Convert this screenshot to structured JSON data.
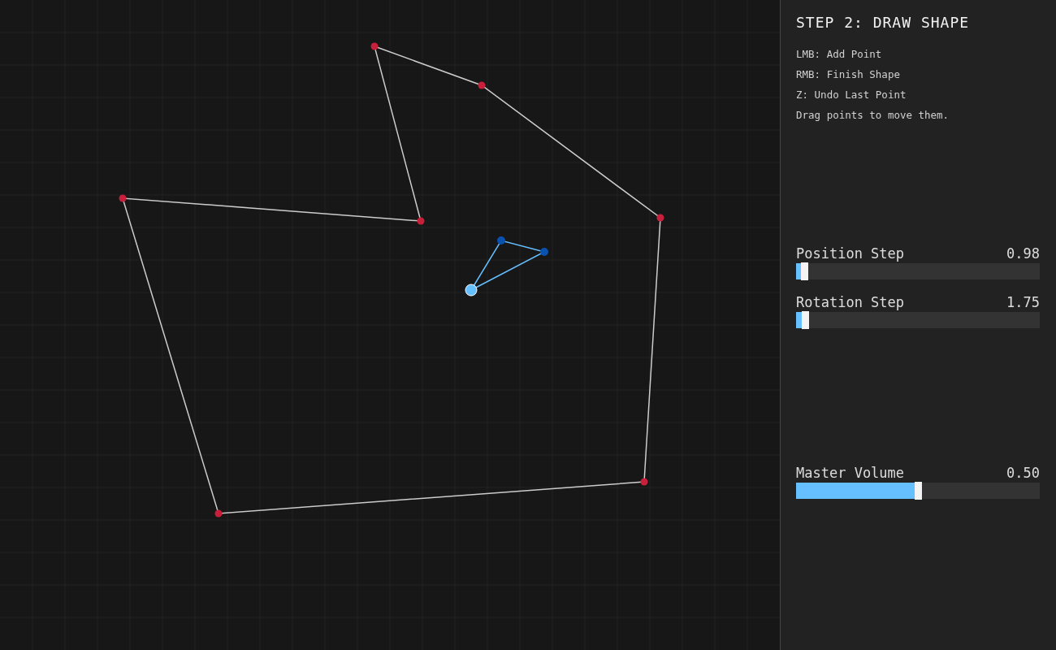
{
  "panel": {
    "title": "STEP 2: DRAW SHAPE",
    "instructions": [
      "LMB: Add Point",
      "RMB: Finish Shape",
      "Z: Undo Last Point",
      "Drag points to move them."
    ],
    "sliders": [
      {
        "label": "Position Step",
        "reading": "0.98",
        "level": 0.033
      },
      {
        "label": "Rotation Step",
        "reading": "1.75",
        "level": 0.037
      },
      {
        "label": "Master Volume",
        "reading": "0.50",
        "level": 0.5
      }
    ]
  }
}
